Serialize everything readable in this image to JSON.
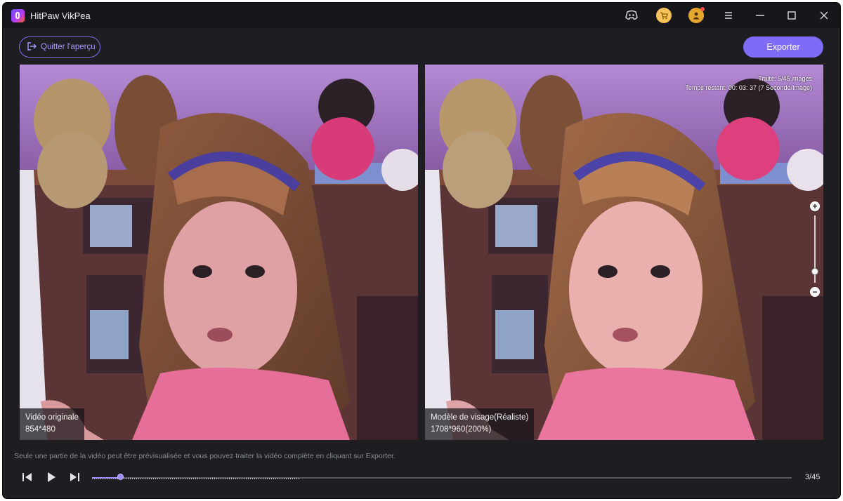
{
  "window": {
    "title": "HitPaw VikPea"
  },
  "titlebar": {
    "icons": [
      "discord-icon",
      "cart-icon",
      "user-icon",
      "menu-icon",
      "minimize-icon",
      "maximize-icon",
      "close-icon"
    ]
  },
  "toolbar": {
    "quit_label": "Quitter l'aperçu",
    "export_label": "Exporter"
  },
  "preview": {
    "original": {
      "title": "Vidéo originale",
      "resolution": "854*480"
    },
    "enhanced": {
      "title": "Modèle de visage(Réaliste)",
      "resolution": "1708*960(200%)",
      "progress_line1": "Traité: 5/45 images",
      "progress_line2": "Temps restant: 00: 03: 37 (7 Seconde/Image)"
    }
  },
  "zoom": {
    "plus": "+",
    "minus": "−",
    "level": 0.17
  },
  "footer": {
    "note": "Seule une partie de la vidéo peut être prévisualisée et vous pouvez traiter la vidéo complète en cliquant sur Exporter.",
    "playhead": 0.04,
    "current_frame": 3,
    "total_frames": 45,
    "counter": "3/45"
  },
  "colors": {
    "accent": "#7f6cf6",
    "background": "#1d1d22",
    "titlebar": "#17171b"
  }
}
